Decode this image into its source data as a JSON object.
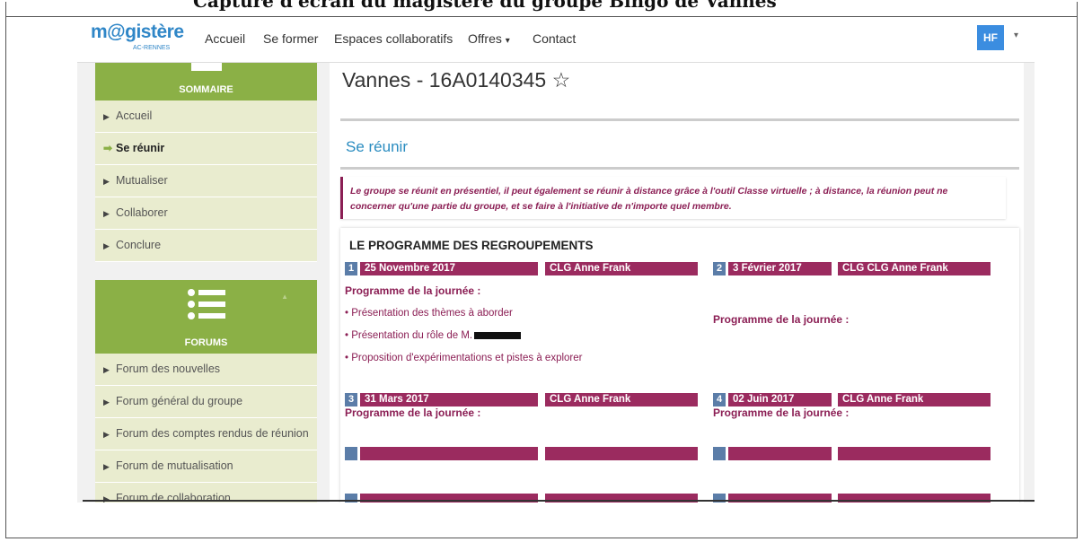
{
  "cutoff_heading": "Capture d'écran du magistère du groupe Bingo de Vannes",
  "navbar": {
    "logo_main": "m@gistère",
    "logo_sub": "AC-RENNES",
    "links": [
      "Accueil",
      "Se former",
      "Espaces collaboratifs",
      "Offres",
      "Contact"
    ],
    "offres_caret": "▾",
    "user_initials": "HF",
    "user_caret": "▾"
  },
  "sidebar": {
    "sommaire_title": "SOMMAIRE",
    "sommaire_items": [
      {
        "label": "Accueil"
      },
      {
        "label": "Se réunir"
      },
      {
        "label": "Mutualiser"
      },
      {
        "label": "Collaborer"
      },
      {
        "label": "Conclure"
      }
    ],
    "forums_title": "FORUMS",
    "forums_items": [
      {
        "label": "Forum des nouvelles"
      },
      {
        "label": "Forum général du groupe"
      },
      {
        "label": "Forum des comptes rendus de réunion"
      },
      {
        "label": "Forum de mutualisation"
      },
      {
        "label": "Forum de collaboration"
      }
    ]
  },
  "main": {
    "page_title": "Vannes - 16A0140345",
    "section_title": "Se réunir",
    "intro_line1": "Le groupe se réunit en présentiel, il peut également se réunir à distance grâce à l'outil Classe virtuelle ; à distance, la réunion peut ne",
    "intro_line2": "concerner qu'une partie du groupe, et se faire à l'initiative de n'importe quel membre.",
    "program_title": "LE PROGRAMME DES REGROUPEMENTS",
    "program_label": "Programme de la journée :",
    "sessions": [
      {
        "num": "1",
        "date": "25 Novembre 2017",
        "place": "CLG Anne Frank",
        "items": [
          "• Présentation des thèmes à aborder",
          "• Présentation du rôle de M.",
          "• Proposition d'expérimentations et pistes à explorer"
        ]
      },
      {
        "num": "2",
        "date": "3 Février 2017",
        "place": "CLG CLG Anne Frank",
        "items": []
      },
      {
        "num": "3",
        "date": "31 Mars 2017",
        "place": "CLG Anne Frank",
        "items": []
      },
      {
        "num": "4",
        "date": "02 Juin 2017",
        "place": "CLG Anne Frank",
        "items": []
      }
    ]
  },
  "colors": {
    "green": "#8bb046",
    "maroon": "#9b2b5f",
    "blue_link": "#2a8cc0",
    "number_blue": "#5b7da8"
  }
}
